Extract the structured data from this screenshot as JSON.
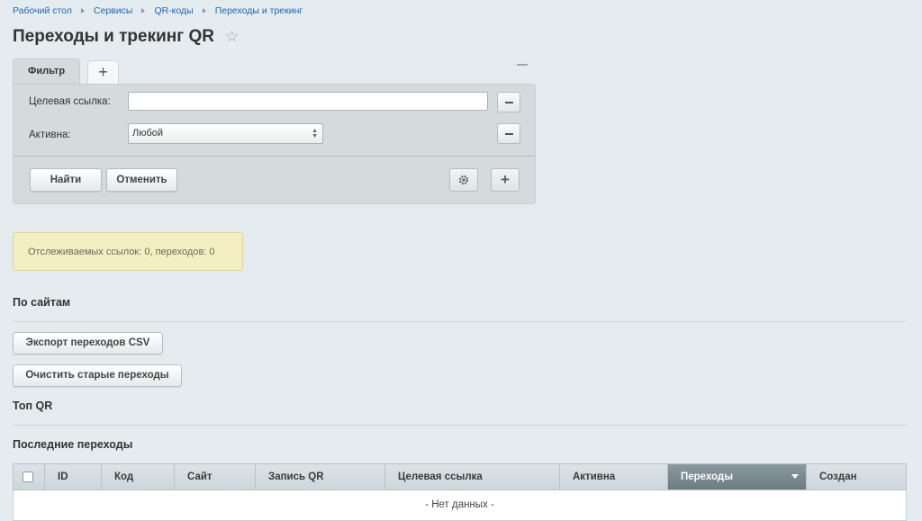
{
  "breadcrumb": [
    "Рабочий стол",
    "Сервисы",
    "QR-коды",
    "Переходы и трекинг"
  ],
  "page_title": "Переходы и трекинг QR",
  "filter": {
    "tab_label": "Фильтр",
    "add_tab": "+",
    "fields": {
      "target_link_label": "Целевая ссылка:",
      "target_link_value": "",
      "active_label": "Активна:",
      "active_value": "Любой"
    },
    "find_button": "Найти",
    "cancel_button": "Отменить",
    "add_button": "+"
  },
  "notice": "Отслеживаемых ссылок: 0, переходов: 0",
  "sections": {
    "by_sites": "По сайтам",
    "export_csv_button": "Экспорт переходов CSV",
    "clear_old_button": "Очистить старые переходы",
    "top_qr": "Топ QR",
    "recent": "Последние переходы"
  },
  "table": {
    "columns": [
      "ID",
      "Код",
      "Сайт",
      "Запись QR",
      "Целевая ссылка",
      "Активна",
      "Переходы",
      "Создан"
    ],
    "sorted_column": "Переходы",
    "empty_text": "- Нет данных -"
  },
  "colors": {
    "background": "#e5ecef",
    "link": "#2067b0",
    "notice_bg": "#f3efc2",
    "sorted_header": "#7a8890"
  },
  "icons": [
    "star-icon",
    "gear-icon",
    "plus-icon",
    "minus-icon",
    "sort-desc-icon"
  ]
}
